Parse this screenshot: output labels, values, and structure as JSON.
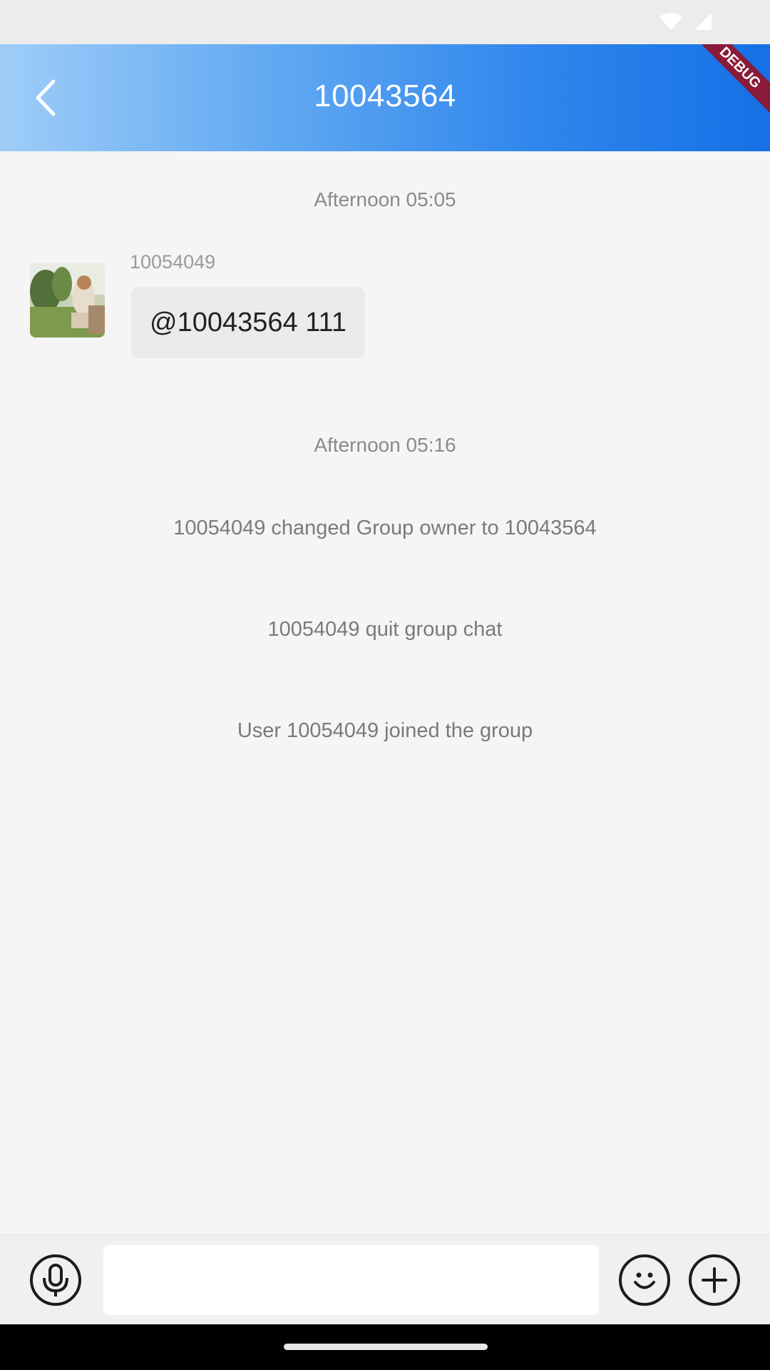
{
  "colors": {
    "header_start": "#9fcdf8",
    "header_end": "#1570e6",
    "debug_banner": "#8a1a3a",
    "background": "#f5f5f5"
  },
  "header": {
    "title": "10043564",
    "back_icon": "chevron-left-icon",
    "debug_label": "DEBUG"
  },
  "chat": {
    "messages": [
      {
        "timestamp": "Afternoon 05:05",
        "sender": "10054049",
        "avatar": "avatar-photo",
        "text": "@10043564 111"
      }
    ],
    "timestamp_2": "Afternoon 05:16",
    "system_messages": [
      "10054049 changed Group owner to  10043564",
      "10054049 quit group chat",
      "User 10054049 joined the group"
    ]
  },
  "input_bar": {
    "voice_icon": "microphone-icon",
    "message_placeholder": "",
    "emoji_icon": "smiley-icon",
    "more_icon": "plus-icon"
  }
}
